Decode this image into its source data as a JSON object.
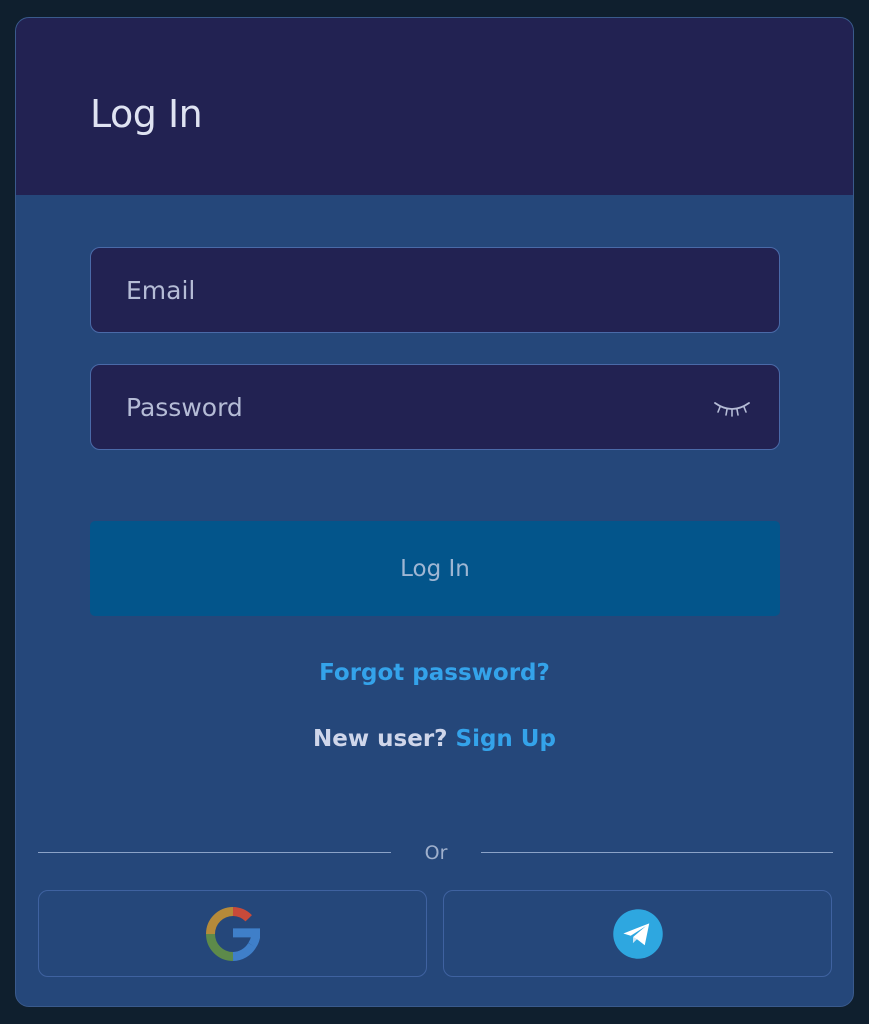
{
  "header": {
    "title": "Log In"
  },
  "form": {
    "email_placeholder": "Email",
    "email_value": "",
    "password_placeholder": "Password",
    "password_value": "",
    "password_toggle_icon": "eye-closed-icon",
    "submit_label": "Log In"
  },
  "links": {
    "forgot_password": "Forgot password?",
    "new_user_prompt": "New user?",
    "sign_up": "Sign Up"
  },
  "divider": {
    "label": "Or"
  },
  "social": {
    "google_icon": "google-icon",
    "telegram_icon": "telegram-icon"
  },
  "colors": {
    "page_background": "#0f1f2e",
    "card_background": "#25477a",
    "header_background": "#222252",
    "input_background": "#222252",
    "primary_button": "#03558b",
    "link": "#34a3ea"
  }
}
